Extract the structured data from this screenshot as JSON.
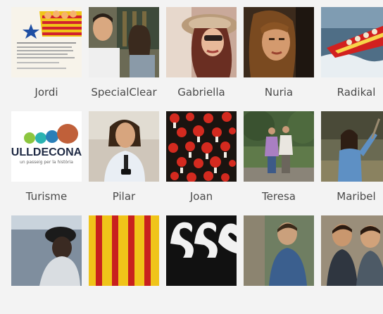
{
  "contacts": [
    {
      "name": "Jordi",
      "thumb": "family-poster-thumbnail"
    },
    {
      "name": "SpecialClear",
      "thumb": "couple-photo-thumbnail"
    },
    {
      "name": "Gabriella",
      "thumb": "woman-with-hat-thumbnail"
    },
    {
      "name": "Nuria",
      "thumb": "woman-portrait-thumbnail"
    },
    {
      "name": "Radikal",
      "thumb": "speedboat-thumbnail"
    },
    {
      "name": "Turisme",
      "thumb": "ulldecona-logo-thumbnail"
    },
    {
      "name": "Pilar",
      "thumb": "woman-smiling-thumbnail"
    },
    {
      "name": "Joan",
      "thumb": "red-flowers-thumbnail"
    },
    {
      "name": "Teresa",
      "thumb": "couple-in-park-thumbnail"
    },
    {
      "name": "Maribel",
      "thumb": "person-in-field-thumbnail"
    },
    {
      "name": "",
      "thumb": "hat-person-thumbnail"
    },
    {
      "name": "",
      "thumb": "catalan-flag-thumbnail"
    },
    {
      "name": "",
      "thumb": "graffiti-art-thumbnail"
    },
    {
      "name": "",
      "thumb": "man-outdoors-thumbnail"
    },
    {
      "name": "",
      "thumb": "two-people-thumbnail"
    }
  ],
  "logo": {
    "text": "ULLDECONA",
    "tagline": "un passeig per la història"
  },
  "colors": {
    "background": "#f3f3f3",
    "name_text": "#4a4a4a"
  }
}
